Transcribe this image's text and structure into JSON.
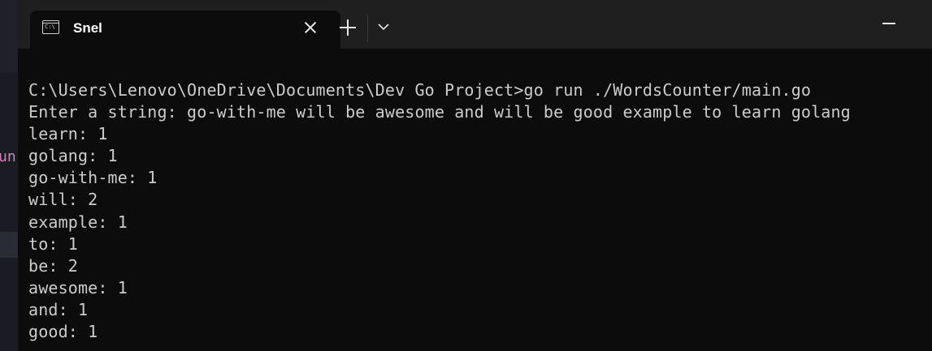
{
  "tab": {
    "title": "Snel",
    "icon": "terminal-icon",
    "icon_glyph": "C:\\"
  },
  "titlebar": {
    "new_tab_icon": "plus-icon",
    "dropdown_icon": "chevron-down-icon",
    "minimize_icon": "minimize-icon",
    "close_tab_icon": "close-icon"
  },
  "background_window": {
    "peek_text": "un"
  },
  "terminal": {
    "lines": [
      "C:\\Users\\Lenovo\\OneDrive\\Documents\\Dev Go Project>go run ./WordsCounter/main.go",
      "Enter a string: go-with-me will be awesome and will be good example to learn golang",
      "learn: 1",
      "golang: 1",
      "go-with-me: 1",
      "will: 2",
      "example: 1",
      "to: 1",
      "be: 2",
      "awesome: 1",
      "and: 1",
      "good: 1"
    ]
  },
  "colors": {
    "terminal_bg": "#0c0c0c",
    "titlebar_bg": "#1f1f1f",
    "text": "#cccccc",
    "peek_accent": "#c586c0"
  }
}
